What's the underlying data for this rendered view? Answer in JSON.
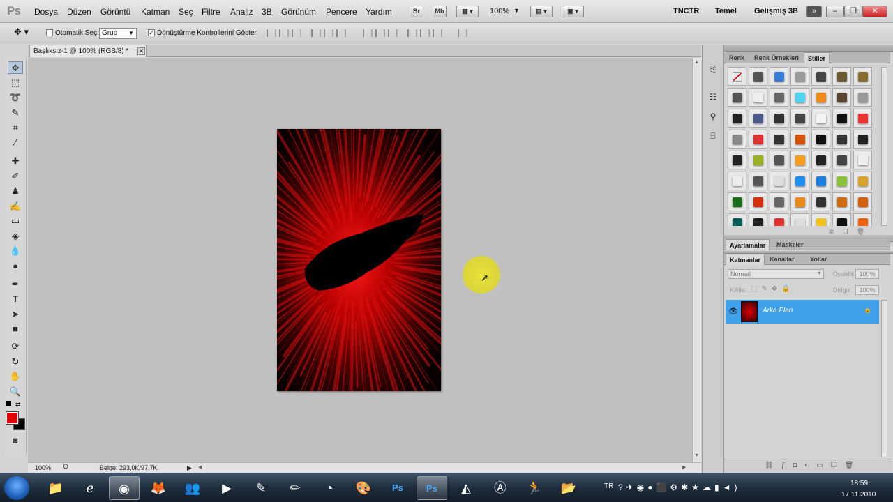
{
  "app": {
    "logo": "Ps"
  },
  "menu": [
    "Dosya",
    "Düzen",
    "Görüntü",
    "Katman",
    "Seç",
    "Filtre",
    "Analiz",
    "3B",
    "Görünüm",
    "Pencere",
    "Yardım"
  ],
  "menubar_buttons": {
    "bridge": "Br",
    "minibridge": "Mb",
    "zoom": "100%"
  },
  "workspaces": [
    "TNCTR",
    "Temel",
    "Gelişmiş 3B"
  ],
  "options": {
    "auto_select_label": "Otomatik Seç:",
    "auto_select_value": "Grup",
    "transform_label": "Dönüştürme Kontrollerini Göster"
  },
  "document": {
    "tab_title": "Başlıksız-1 @ 100% (RGB/8) *"
  },
  "status": {
    "zoom": "100%",
    "doc_info": "Belge: 293,0K/97,7K"
  },
  "styles_panel": {
    "tabs": [
      "Renk",
      "Renk Örnekleri",
      "Stiller"
    ],
    "active": "Stiller"
  },
  "adjust_panel": {
    "tabs": [
      "Ayarlamalar",
      "Maskeler"
    ]
  },
  "layers_panel": {
    "tabs": [
      "Katmanlar",
      "Kanallar",
      "Yollar"
    ],
    "blend_mode": "Normal",
    "opacity_label": "Opaklık:",
    "opacity_value": "100%",
    "lock_label": "Kilitle:",
    "fill_label": "Dolgu:",
    "fill_value": "100%",
    "layers": [
      {
        "name": "Arka Plan"
      }
    ]
  },
  "taskbar": {
    "lang": "TR",
    "time": "18:59",
    "date": "17.11.2010"
  },
  "colors": {
    "foreground": "#e00000",
    "background": "#000000",
    "layer_selected": "#3ea1ea"
  }
}
